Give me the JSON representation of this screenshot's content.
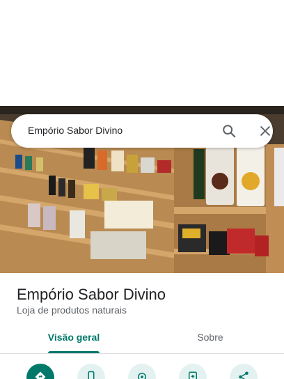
{
  "search": {
    "query": "Empório Sabor Divino",
    "search_icon": "search-icon",
    "close_icon": "close-icon"
  },
  "place": {
    "name": "Empório Sabor Divino",
    "category": "Loja de produtos naturais",
    "photo": "store-shelves-photo"
  },
  "tabs": [
    {
      "label": "Visão geral",
      "selected": true
    },
    {
      "label": "Sobre",
      "selected": false
    }
  ],
  "actions": [
    {
      "icon": "directions-icon"
    },
    {
      "icon": "phone-icon"
    },
    {
      "icon": "location-icon"
    },
    {
      "icon": "save-icon"
    },
    {
      "icon": "share-icon"
    }
  ],
  "colors": {
    "accent": "#00796b",
    "text_primary": "#202124",
    "text_secondary": "#5f6368"
  }
}
